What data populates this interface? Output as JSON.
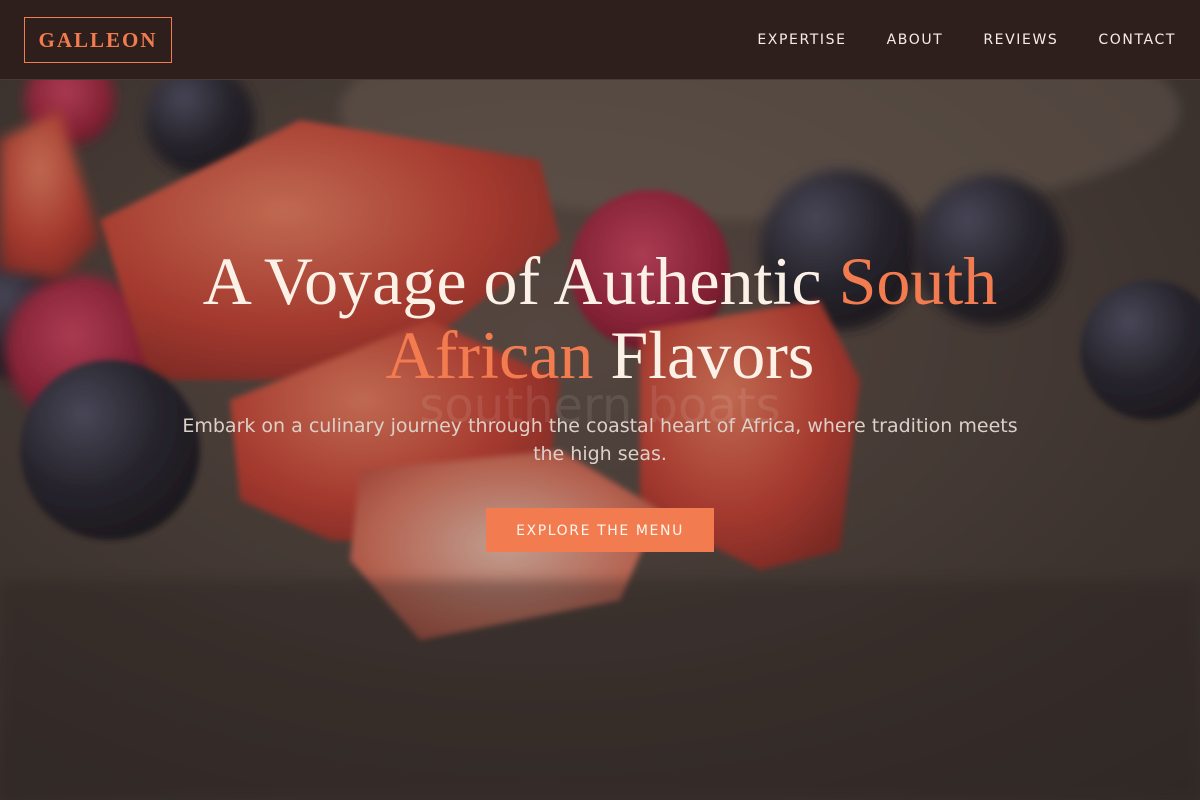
{
  "brand": {
    "name": "GALLEON",
    "accent_color": "#f27c4f",
    "nav_bg_color": "#2e1f1c"
  },
  "nav": {
    "items": [
      {
        "label": "EXPERTISE"
      },
      {
        "label": "ABOUT"
      },
      {
        "label": "REVIEWS"
      },
      {
        "label": "CONTACT"
      }
    ]
  },
  "hero": {
    "title_part1": "A Voyage of Authentic ",
    "title_accent1": "South",
    "title_accent2": "African",
    "title_part2": " Flavors",
    "watermark": "southern boats",
    "subtitle": "Embark on a culinary journey through the coastal heart of Africa, where tradition meets the high seas.",
    "cta_label": "EXPLORE THE MENU",
    "background": "berries-and-strawberries-photo"
  }
}
